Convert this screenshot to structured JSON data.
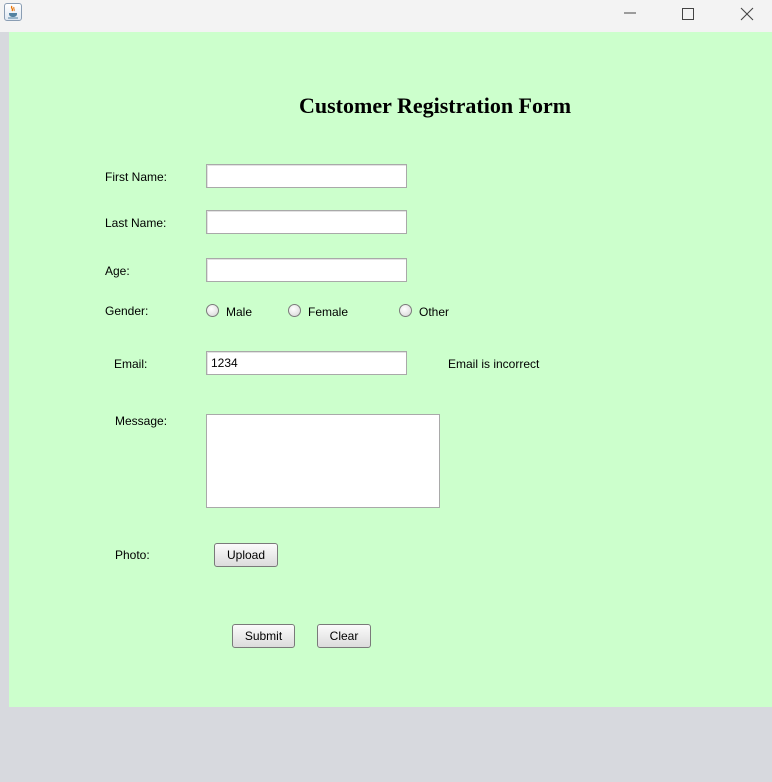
{
  "window": {
    "app_icon": "java-cup-icon",
    "controls": [
      "minimize-icon",
      "maximize-icon",
      "close-icon"
    ]
  },
  "form": {
    "title": "Customer Registration Form",
    "first_name_label": "First Name:",
    "first_name_value": "",
    "last_name_label": "Last Name:",
    "last_name_value": "",
    "age_label": "Age:",
    "age_value": "",
    "gender_label": "Gender:",
    "gender_options": [
      "Male",
      "Female",
      "Other"
    ],
    "email_label": "Email:",
    "email_value": "1234",
    "email_error": "Email is incorrect",
    "message_label": "Message:",
    "message_value": "",
    "photo_label": "Photo:",
    "upload_button": "Upload",
    "submit_button": "Submit",
    "clear_button": "Clear"
  },
  "colors": {
    "panel_background": "#ccffcc",
    "window_background": "#d7d9de",
    "titlebar_background": "#f3f3f3"
  }
}
